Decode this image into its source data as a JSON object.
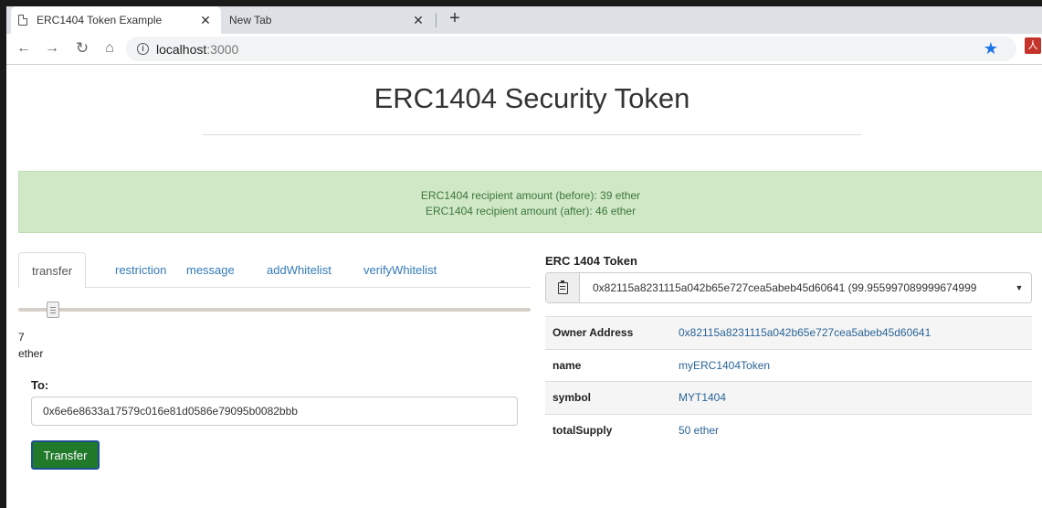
{
  "browser": {
    "tabs": [
      {
        "title": "ERC1404 Token Example",
        "active": true
      },
      {
        "title": "New Tab",
        "active": false
      }
    ],
    "url_host": "localhost",
    "url_port": ":3000"
  },
  "page": {
    "title": "ERC1404 Security Token",
    "alert": {
      "line1": "ERC1404 recipient amount (before): 39 ether",
      "line2": "ERC1404 recipient amount (after): 46 ether"
    },
    "tabs": [
      "transfer",
      "restriction",
      "message",
      "addWhitelist",
      "verifyWhitelist"
    ],
    "active_tab": "transfer",
    "slider_value": 7,
    "amount_value": "7",
    "amount_unit": "ether",
    "to_label": "To:",
    "to_value": "0x6e6e8633a17579c016e81d0586e79095b0082bbb",
    "transfer_label": "Transfer"
  },
  "token": {
    "heading": "ERC 1404 Token",
    "account": "0x82115a8231115a042b65e727cea5abeb45d60641 (99.955997089999674999",
    "rows": [
      {
        "key": "Owner Address",
        "value": "0x82115a8231115a042b65e727cea5abeb45d60641"
      },
      {
        "key": "name",
        "value": "myERC1404Token"
      },
      {
        "key": "symbol",
        "value": "MYT1404"
      },
      {
        "key": "totalSupply",
        "value": "50 ether"
      }
    ]
  },
  "colors": {
    "alert_bg": "#d0e8c6",
    "alert_text": "#3c763d",
    "link": "#337ab7",
    "button_bg": "#217a2a",
    "star": "#1a73e8"
  }
}
